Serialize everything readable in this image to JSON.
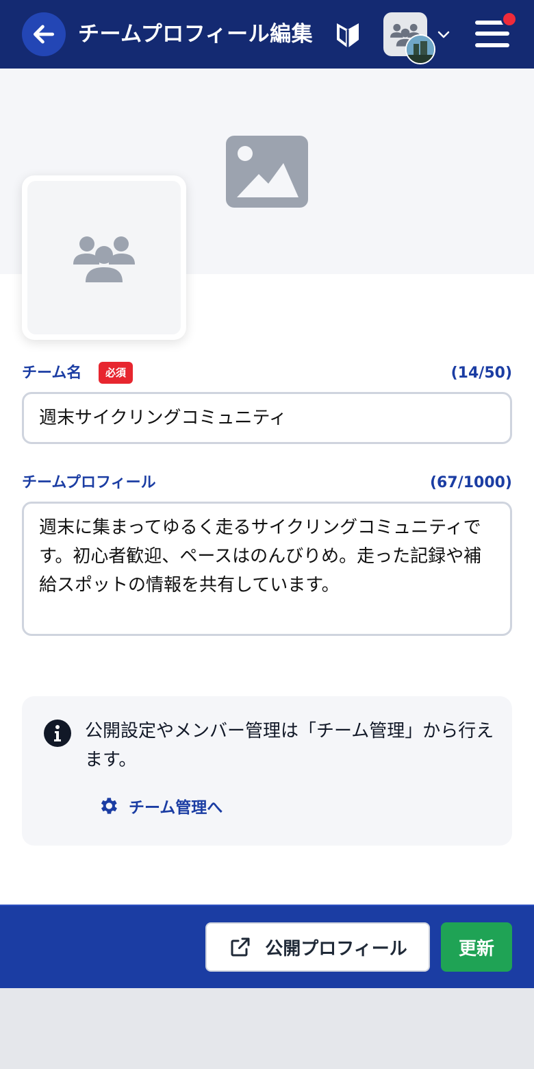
{
  "header": {
    "title": "チームプロフィール編集",
    "back_icon": "arrow-left-icon",
    "beginner_icon": "beginner-mark-icon",
    "team_avatar_icon": "users-icon",
    "menu_icon": "hamburger-icon"
  },
  "cover": {
    "placeholder_icon": "image-icon",
    "team_image_icon": "users-icon"
  },
  "team_name": {
    "label": "チーム名",
    "required_badge": "必須",
    "counter": "(14/50)",
    "value": "週末サイクリングコミュニティ"
  },
  "team_profile": {
    "label": "チームプロフィール",
    "counter": "(67/1000)",
    "value": "週末に集まってゆるく走るサイクリングコミュニティです。初心者歓迎、ペースはのんびりめ。走った記録や補給スポットの情報を共有しています。"
  },
  "info": {
    "icon": "info-icon",
    "text": "公開設定やメンバー管理は「チーム管理」から行えます。",
    "link_icon": "gear-icon",
    "link_label": "チーム管理へ"
  },
  "footer": {
    "public_profile_icon": "external-link-icon",
    "public_profile_label": "公開プロフィール",
    "update_label": "更新"
  },
  "colors": {
    "header_bg": "#142a72",
    "primary": "#1b3da3",
    "required": "#e7262f",
    "update": "#1fa355",
    "notification": "#ef2b3a"
  }
}
